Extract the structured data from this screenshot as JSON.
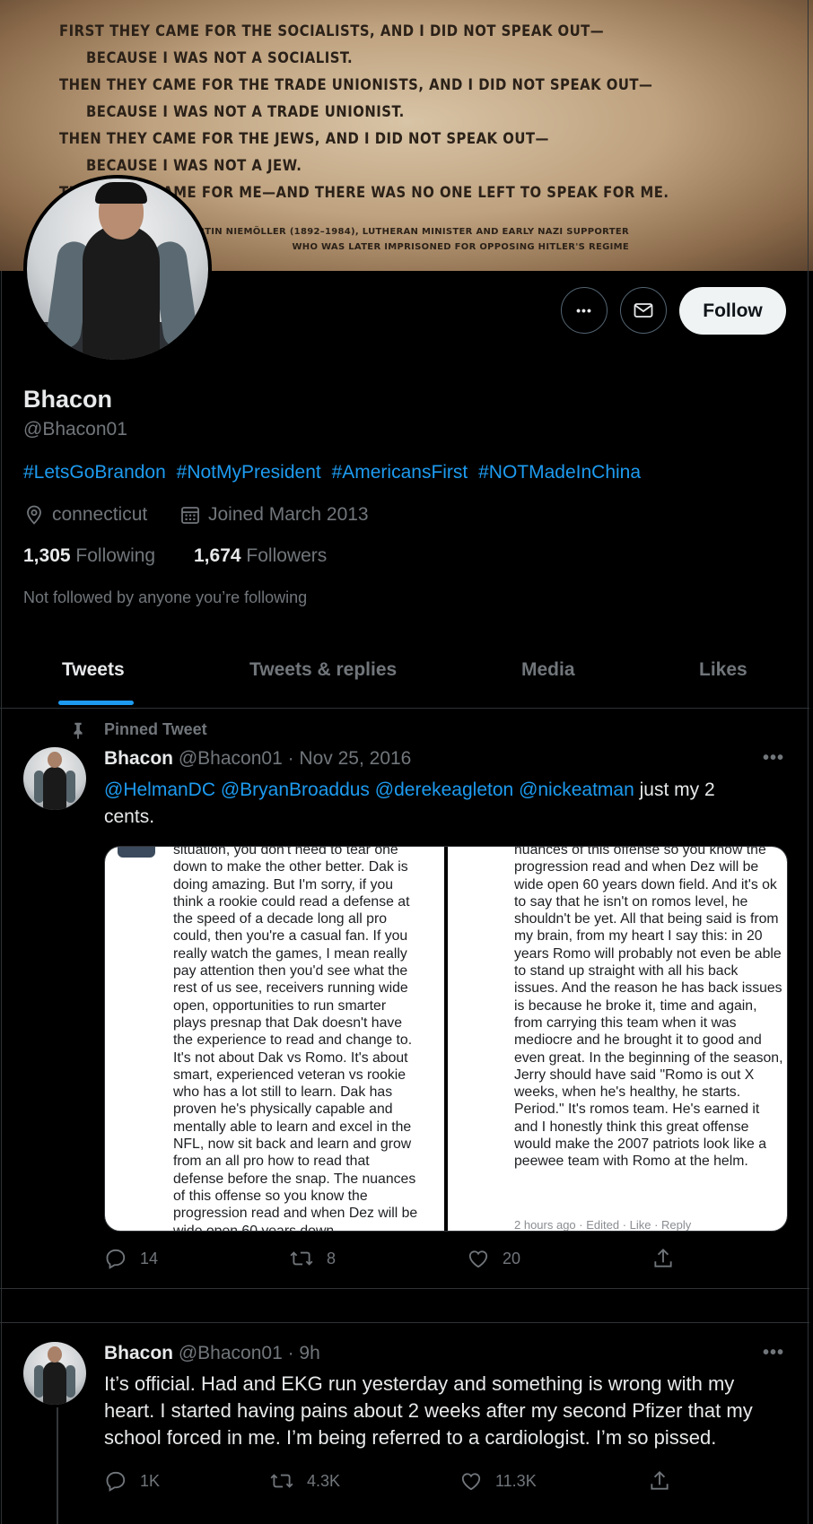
{
  "banner": {
    "lines": [
      "FIRST THEY CAME FOR THE SOCIALISTS, AND I DID NOT SPEAK OUT—",
      "BECAUSE I WAS NOT A SOCIALIST.",
      "THEN THEY CAME FOR THE TRADE UNIONISTS, AND I DID NOT SPEAK OUT—",
      "BECAUSE I WAS NOT A TRADE UNIONIST.",
      "THEN THEY CAME FOR THE JEWS, AND I DID NOT SPEAK OUT—",
      "BECAUSE I WAS NOT A JEW.",
      "THEN THEY CAME FOR ME—AND THERE WAS NO ONE LEFT TO SPEAK FOR ME."
    ],
    "attribution_1": "MARTIN NIEMÖLLER (1892–1984), LUTHERAN MINISTER AND EARLY NAZI SUPPORTER",
    "attribution_2": "WHO WAS LATER IMPRISONED FOR OPPOSING HITLER'S REGIME"
  },
  "profile": {
    "name": "Bhacon",
    "handle": "@Bhacon01",
    "bio_tags": [
      "#LetsGoBrandon",
      "#NotMyPresident",
      "#AmericansFirst",
      "#NOTMadeInChina"
    ],
    "location": "connecticut",
    "joined": "Joined March 2013",
    "following_count": "1,305",
    "following_label": "Following",
    "followers_count": "1,674",
    "followers_label": "Followers",
    "not_followed": "Not followed by anyone you’re following",
    "follow_label": "Follow",
    "more_label": "•••"
  },
  "tabs": [
    {
      "label": "Tweets",
      "active": true
    },
    {
      "label": "Tweets & replies",
      "active": false
    },
    {
      "label": "Media",
      "active": false
    },
    {
      "label": "Likes",
      "active": false
    }
  ],
  "tweets": [
    {
      "pinned_label": "Pinned Tweet",
      "name": "Bhacon",
      "handle": "@Bhacon01",
      "time": "· Nov 25, 2016",
      "mentions": [
        "@HelmanDC",
        "@BryanBroaddus",
        "@derekeagleton",
        "@nickeatman"
      ],
      "text": "just my 2 cents.",
      "media": {
        "left_pane": "situation, you don't need to tear one down to make the other better. Dak is doing amazing. But I'm sorry, if you think a rookie could read a defense at the speed of a decade long all pro could, then you're a casual fan. If you really watch the games, I mean really pay attention then you'd see what the rest of us see, receivers running wide open, opportunities to run smarter plays presnap that Dak doesn't have the experience to read and change to. It's not about Dak vs Romo. It's about smart, experienced veteran vs rookie who has a lot still to learn. Dak has proven he's physically capable and mentally able to learn and excel in the NFL, now sit back and learn and grow from an all pro how to read that defense before the snap. The nuances of this offense so you know the progression read and when Dez will be wide open 60 years down",
        "right_pane": "nuances of this offense so you know the progression read and when Dez will be wide open 60 years down field. And it's ok to say that he isn't on romos level, he shouldn't be yet. All that being said is from my brain, from my heart I say this: in 20 years Romo will probably not even be able to stand up straight with all his back issues. And the reason he has back issues is because he broke it, time and again, from carrying this team when it was mediocre and he brought it to good and even great. In the beginning of the season, Jerry should have said \"Romo is out X weeks, when he's healthy, he starts. Period.\" It's romos team. He's earned it and I honestly think this great offense would make the 2007 patriots look like a peewee team with Romo at the helm.",
        "right_footer": "2 hours ago · Edited · Like · Reply"
      },
      "replies": "14",
      "retweets": "8",
      "likes": "20"
    },
    {
      "name": "Bhacon",
      "handle": "@Bhacon01",
      "time": "· 9h",
      "text": "It’s official. Had and EKG run yesterday and something is wrong with my heart. I started having pains about 2 weeks after my second Pfizer that my school forced in me. I’m being referred to a cardiologist. I’m so pissed.",
      "replies": "1K",
      "retweets": "4.3K",
      "likes": "11.3K"
    }
  ],
  "colors": {
    "accent": "#1d9bf0",
    "background": "#000000",
    "text": "#e7e9ea",
    "muted": "#71767b",
    "border": "#2f3336"
  },
  "icons": [
    "location-icon",
    "calendar-icon",
    "more-icon",
    "mail-icon",
    "pin-icon",
    "reply-icon",
    "retweet-icon",
    "like-icon",
    "share-icon"
  ]
}
